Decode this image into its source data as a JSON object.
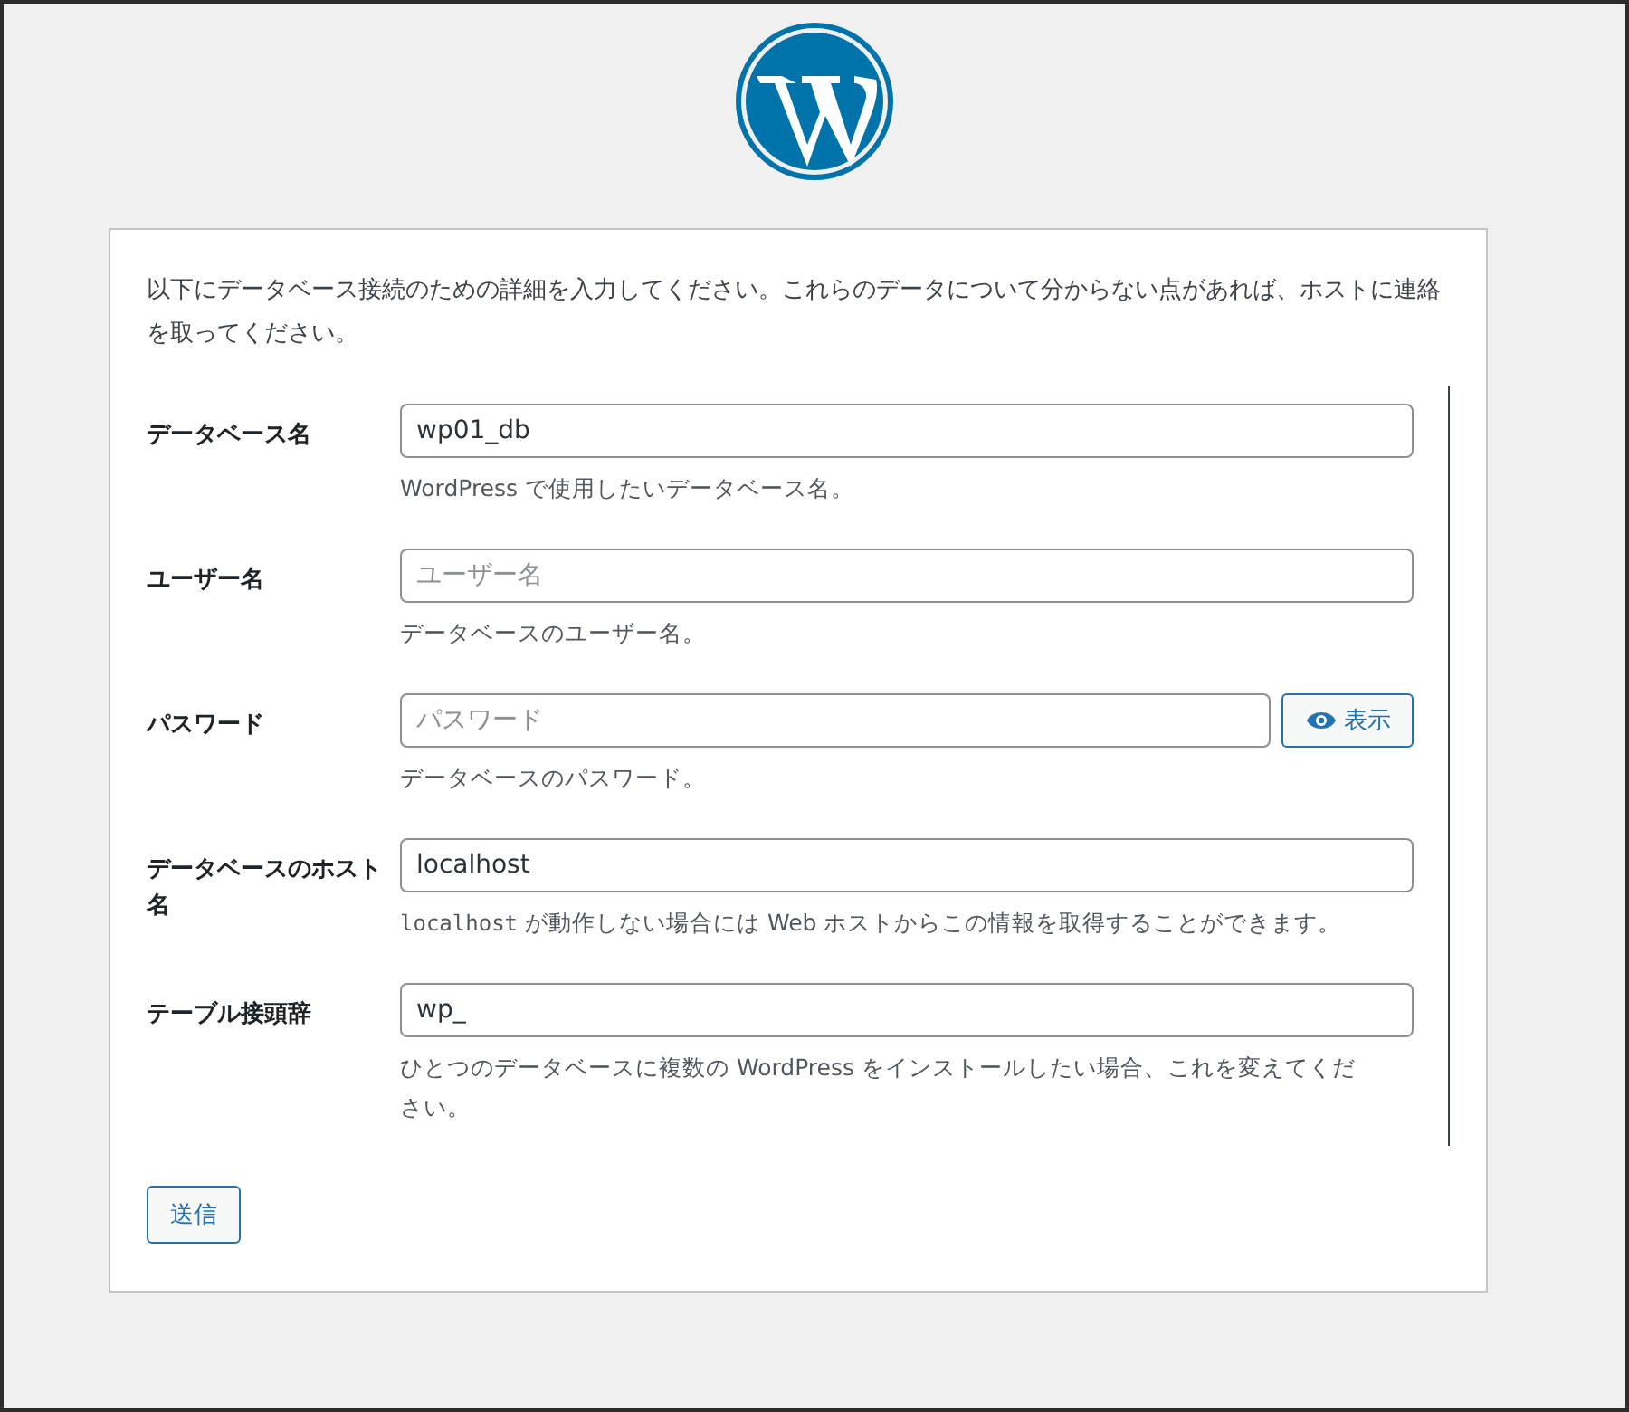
{
  "intro": "以下にデータベース接続のための詳細を入力してください。これらのデータについて分からない点があれば、ホストに連絡を取ってください。",
  "fields": [
    {
      "label": "データベース名",
      "value": "wp01_db",
      "description": [
        {
          "kind": "text",
          "text": "WordPress で使用したいデータベース名。"
        }
      ]
    },
    {
      "label": "ユーザー名",
      "placeholder": "ユーザー名",
      "description": [
        {
          "kind": "text",
          "text": "データベースのユーザー名。"
        }
      ]
    },
    {
      "label": "パスワード",
      "placeholder": "パスワード",
      "toggle": "表示",
      "description": [
        {
          "kind": "text",
          "text": "データベースのパスワード。"
        }
      ]
    },
    {
      "label": "データベースのホスト名",
      "value": "localhost",
      "description": [
        {
          "kind": "code",
          "text": "localhost"
        },
        {
          "kind": "text",
          "text": " が動作しない場合には Web ホストからこの情報を取得することができます。"
        }
      ]
    },
    {
      "label": "テーブル接頭辞",
      "value": "wp_",
      "description": [
        {
          "kind": "text",
          "text": "ひとつのデータベースに複数の WordPress をインストールしたい場合、これを変えてください。"
        }
      ]
    }
  ],
  "submit": "送信"
}
